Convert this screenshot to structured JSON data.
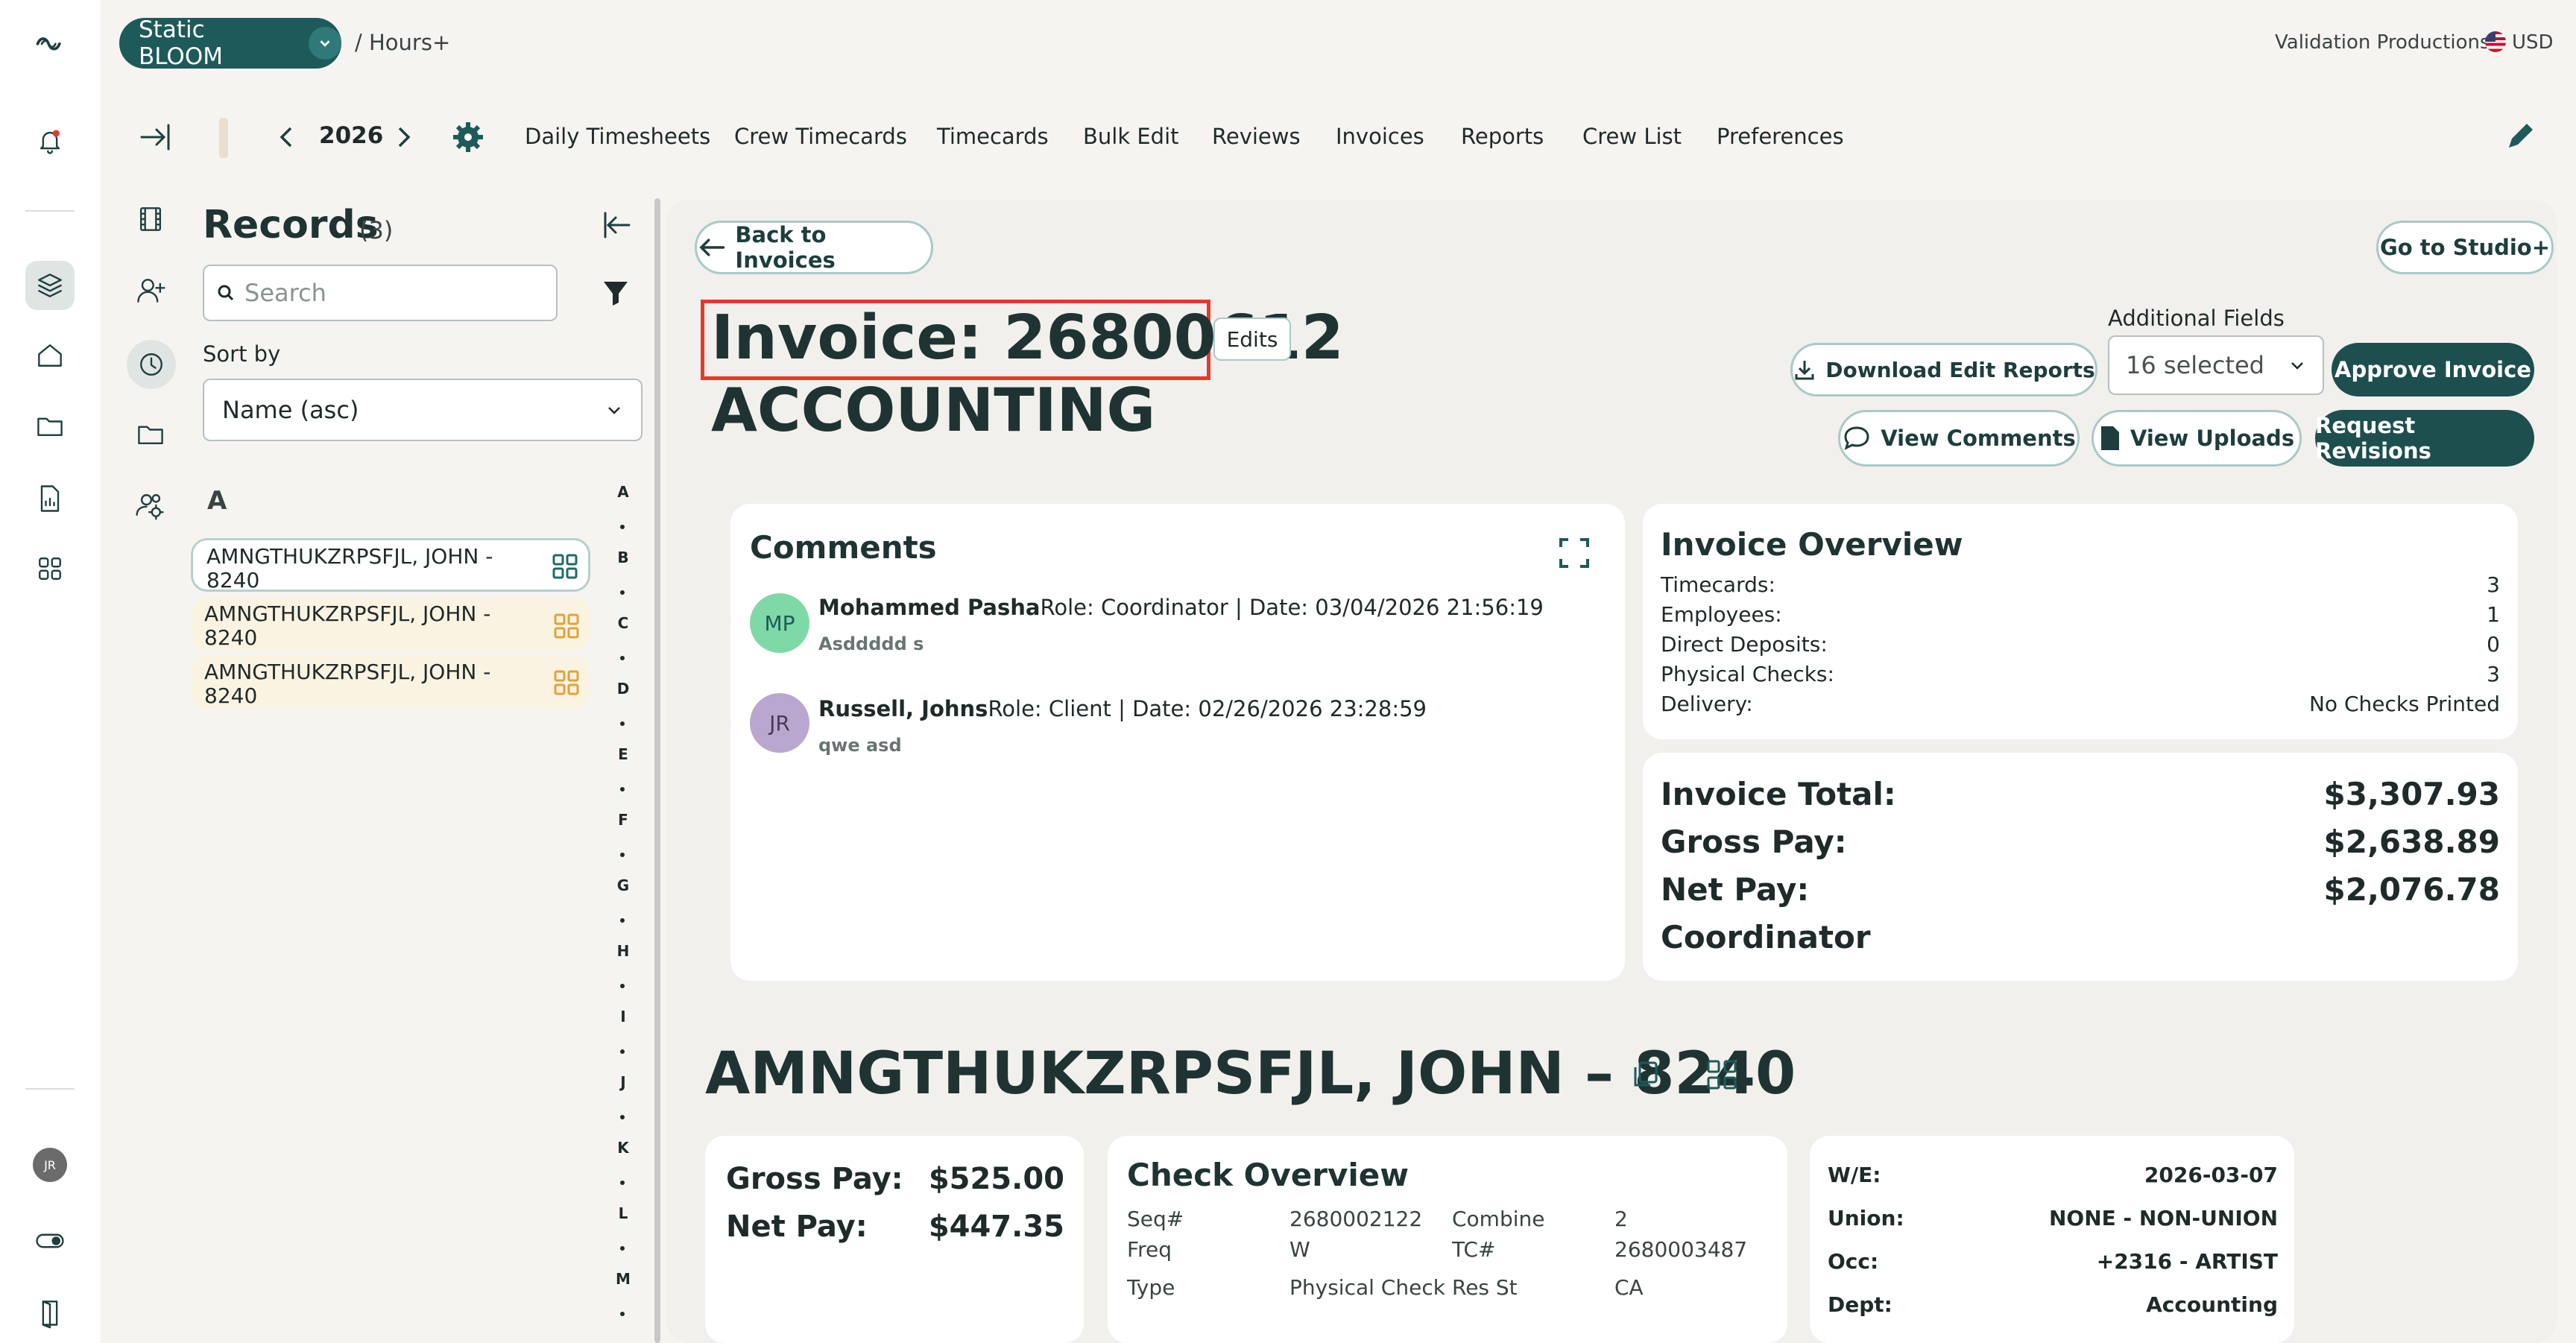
{
  "top": {
    "org_name": "Static BLOOM",
    "breadcrumb": "/ Hours+",
    "company": "Validation Productions",
    "currency": "USD"
  },
  "nav": {
    "year": "2026",
    "items": [
      "Daily Timesheets",
      "Crew Timecards",
      "Timecards",
      "Bulk Edit",
      "Reviews",
      "Invoices",
      "Reports",
      "Crew List",
      "Preferences"
    ]
  },
  "sidebar": {
    "user_initials": "JR"
  },
  "records": {
    "title": "Records",
    "count": "(3)",
    "search_placeholder": "Search",
    "sort_label": "Sort by",
    "sort_value": "Name (asc)",
    "group_letter": "A",
    "items": [
      {
        "line1": "AMNGTHUKZRPSFJL, JOHN -",
        "line2": "8240"
      },
      {
        "line1": "AMNGTHUKZRPSFJL, JOHN -",
        "line2": "8240"
      },
      {
        "line1": "AMNGTHUKZRPSFJL, JOHN -",
        "line2": "8240"
      }
    ],
    "alphabet": [
      "A",
      "B",
      "C",
      "D",
      "E",
      "F",
      "G",
      "H",
      "I",
      "J",
      "K",
      "L",
      "M"
    ]
  },
  "invoice": {
    "back_label": "Back to Invoices",
    "studio_label": "Go to Studio+",
    "title": "Invoice: 26800612",
    "edits_label": "Edits",
    "subtitle": "ACCOUNTING",
    "additional_fields_label": "Additional Fields",
    "additional_fields_value": "16 selected",
    "download_label": "Download Edit Reports",
    "approve_label": "Approve Invoice",
    "view_comments_label": "View Comments",
    "view_uploads_label": "View Uploads",
    "request_revisions_label": "Request Revisions"
  },
  "comments": {
    "title": "Comments",
    "items": [
      {
        "initials": "MP",
        "name": "Mohammed Pasha",
        "meta": "Role: Coordinator | Date: 03/04/2026 21:56:19",
        "text": "Asddddd s",
        "color": "#7fd9a6"
      },
      {
        "initials": "JR",
        "name": "Russell, Johns",
        "meta": "Role: Client | Date: 02/26/2026 23:28:59",
        "text": "qwe asd",
        "color": "#b9a7cf"
      }
    ]
  },
  "overview": {
    "title": "Invoice Overview",
    "rows": [
      {
        "label": "Timecards:",
        "value": "3"
      },
      {
        "label": "Employees:",
        "value": "1"
      },
      {
        "label": "Direct Deposits:",
        "value": "0"
      },
      {
        "label": "Physical Checks:",
        "value": "3"
      },
      {
        "label": "Delivery:",
        "value": "No Checks Printed"
      }
    ],
    "totals": [
      {
        "label": "Invoice Total:",
        "value": "$3,307.93"
      },
      {
        "label": "Gross Pay:",
        "value": "$2,638.89"
      },
      {
        "label": "Net Pay:",
        "value": "$2,076.78"
      }
    ],
    "role": "Coordinator"
  },
  "employee": {
    "name": "AMNGTHUKZRPSFJL, JOHN – 8240",
    "gross_label": "Gross Pay:",
    "gross_value": "$525.00",
    "net_label": "Net Pay:",
    "net_value": "$447.35",
    "check_title": "Check Overview",
    "check_rows": [
      {
        "k1": "Seq#",
        "v1": "2680002122",
        "k2": "Combine",
        "v2": "2"
      },
      {
        "k1": "Freq",
        "v1": "W",
        "k2": "TC#",
        "v2": "2680003487"
      },
      {
        "k1": "Type",
        "v1": "Physical Check",
        "k2": "Res St",
        "v2": "CA"
      }
    ],
    "details": [
      {
        "label": "W/E:",
        "value": "2026-03-07"
      },
      {
        "label": "Union:",
        "value": "NONE - NON-UNION"
      },
      {
        "label": "Occ:",
        "value": "+2316 - ARTIST"
      },
      {
        "label": "Dept:",
        "value": "Accounting"
      }
    ]
  },
  "colors": {
    "brand": "#1e5a5a",
    "accent": "#1d4f4f",
    "highlight": "#e23b2e"
  }
}
